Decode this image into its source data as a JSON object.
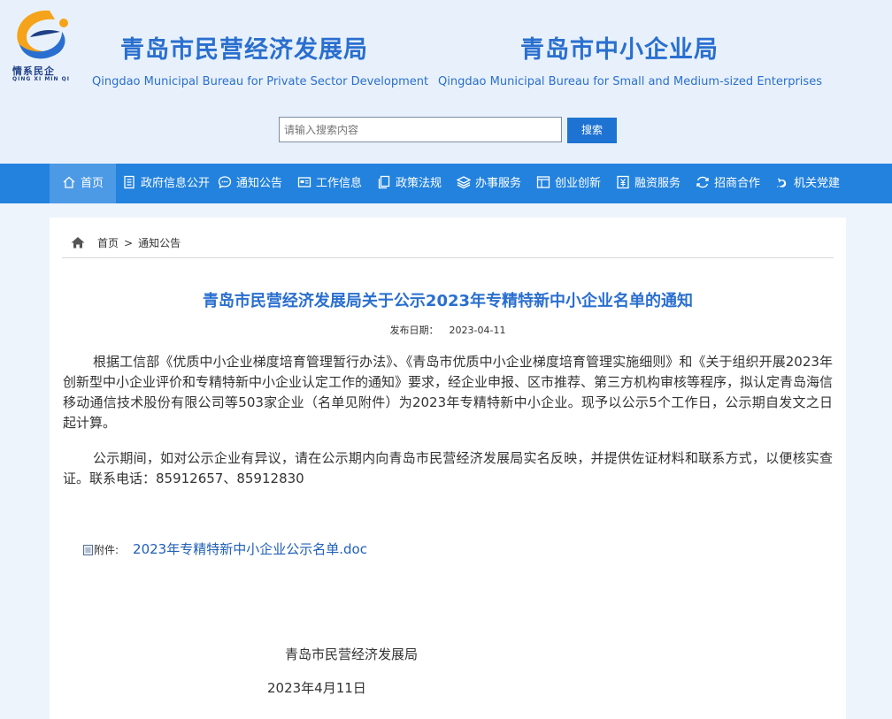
{
  "logo": {
    "text": "情系民企",
    "sub": "QING XI MIN QI"
  },
  "header": {
    "org1_cn": "青岛市民营经济发展局",
    "org1_en": "Qingdao Municipal Bureau for Private Sector Development",
    "org2_cn": "青岛市中小企业局",
    "org2_en": "Qingdao Municipal Bureau for Small and Medium-sized Enterprises"
  },
  "search": {
    "placeholder": "请输入搜索内容",
    "button": "搜索"
  },
  "nav": {
    "items": [
      {
        "label": "首页",
        "icon": "home-icon"
      },
      {
        "label": "政府信息公开",
        "icon": "document-icon"
      },
      {
        "label": "通知公告",
        "icon": "chat-icon"
      },
      {
        "label": "工作信息",
        "icon": "card-icon"
      },
      {
        "label": "政策法规",
        "icon": "copy-icon"
      },
      {
        "label": "办事服务",
        "icon": "layers-icon"
      },
      {
        "label": "创业创新",
        "icon": "window-icon"
      },
      {
        "label": "融资服务",
        "icon": "money-icon"
      },
      {
        "label": "招商合作",
        "icon": "refresh-icon"
      },
      {
        "label": "机关党建",
        "icon": "party-emblem-icon"
      }
    ]
  },
  "breadcrumb": {
    "home": "首页",
    "separator": ">",
    "current": "通知公告"
  },
  "article": {
    "title": "青岛市民营经济发展局关于公示2023年专精特新中小企业名单的通知",
    "date_label": "发布日期：",
    "date": "2023-04-11",
    "paragraph1": "根据工信部《优质中小企业梯度培育管理暂行办法》、《青岛市优质中小企业梯度培育管理实施细则》和《关于组织开展2023年创新型中小企业评价和专精特新中小企业认定工作的通知》要求，经企业申报、区市推荐、第三方机构审核等程序，拟认定青岛海信移动通信技术股份有限公司等503家企业（名单见附件）为2023年专精特新中小企业。现予以公示5个工作日，公示期自发文之日起计算。",
    "paragraph2": "公示期间，如对公示企业有异议，请在公示期内向青岛市民营经济发展局实名反映，并提供佐证材料和联系方式，以便核实查证。联系电话：85912657、85912830",
    "attachment_label": "附件:",
    "attachment_name": "2023年专精特新中小企业公示名单.doc",
    "signature": "青岛市民营经济发展局",
    "sign_date": "2023年4月11日"
  },
  "colors": {
    "primary": "#2282dd",
    "title": "#2a6fcf",
    "nav_active": "#4c9ae6"
  }
}
